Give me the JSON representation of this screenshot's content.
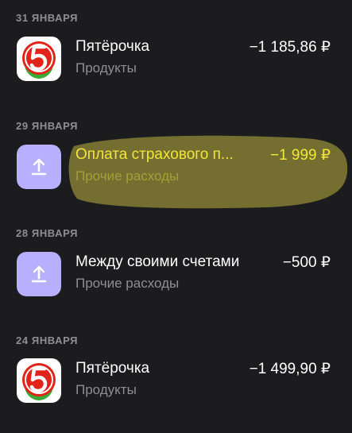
{
  "colors": {
    "background": "#1c1c1e",
    "primary_text": "#ffffff",
    "secondary_text": "#8e8e93",
    "highlight": "#efe24b",
    "pyaterochka_red": "#e2231a",
    "pyaterochka_green": "#3aa935",
    "transfer_icon_bg": "#b8b0ff"
  },
  "groups": [
    {
      "date": "31 ЯНВАРЯ",
      "transactions": [
        {
          "icon": "pyaterochka-logo-icon",
          "title": "Пятёрочка",
          "category": "Продукты",
          "amount": "−1 185,86 ₽"
        }
      ]
    },
    {
      "date": "29 ЯНВАРЯ",
      "transactions": [
        {
          "icon": "upload-arrow-icon",
          "title": "Оплата страхового п...",
          "category": "Прочие расходы",
          "amount": "−1 999 ₽",
          "highlighted": true
        }
      ]
    },
    {
      "date": "28 ЯНВАРЯ",
      "transactions": [
        {
          "icon": "upload-arrow-icon",
          "title": "Между своими счетами",
          "category": "Прочие расходы",
          "amount": "−500 ₽"
        }
      ]
    },
    {
      "date": "24 ЯНВАРЯ",
      "transactions": [
        {
          "icon": "pyaterochka-logo-icon",
          "title": "Пятёрочка",
          "category": "Продукты",
          "amount": "−1 499,90 ₽"
        }
      ]
    }
  ]
}
